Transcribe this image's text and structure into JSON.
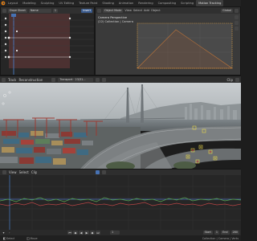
{
  "topbar": {
    "tabs": [
      "Layout",
      "Modeling",
      "Sculpting",
      "UV Editing",
      "Texture Paint",
      "Shading",
      "Animation",
      "Rendering",
      "Compositing",
      "Scripting",
      "Motion Tracking"
    ],
    "active_tab": "Motion Tracking"
  },
  "dopesheet": {
    "mode": "Dope Sheet",
    "name_field": "Name",
    "frame": "1",
    "insert_label": "Insert"
  },
  "viewport": {
    "mode": "Object Mode",
    "menu": [
      "View",
      "Select",
      "Add",
      "Object"
    ],
    "orientation": "Global",
    "title": "Camera Perspective",
    "subtitle": "(22) Collection | Camera"
  },
  "clip_header": {
    "editor": "Track",
    "mode": "Reconstruction",
    "clip_name": "Transport · 23/31...",
    "clip_label": "Clip"
  },
  "graph_header": {
    "view": "View",
    "select": "Select",
    "clip": "Clip"
  },
  "timeline": {
    "start_label": "Start",
    "start": "1",
    "end_label": "End",
    "end": "280",
    "frame": "1"
  },
  "status": {
    "left": "Select",
    "middle": "Move",
    "right": "Collection | Camera | Verts"
  },
  "colors": {
    "accent": "#4772b3",
    "track_yellow": "#e8d84a",
    "track_red": "#d43a3a",
    "graph_green": "#56a54e",
    "graph_red": "#b94545",
    "graph_blue": "#4f72c4"
  }
}
